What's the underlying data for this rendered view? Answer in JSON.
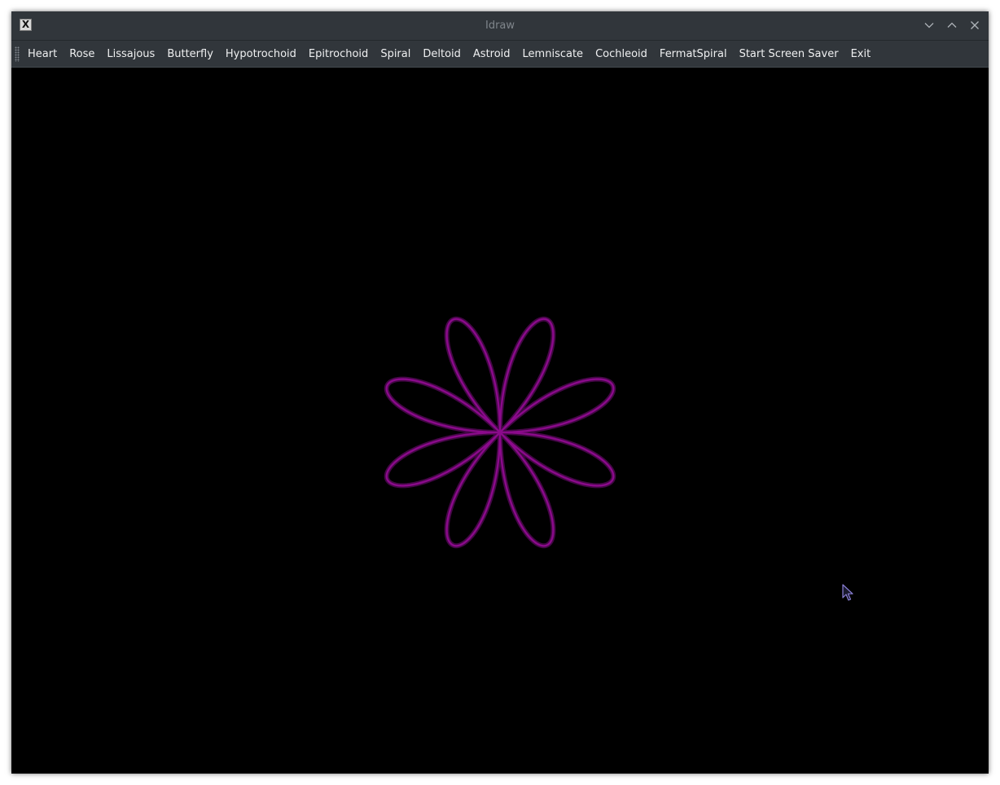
{
  "window": {
    "title": "Idraw",
    "app_icon_glyph": "X"
  },
  "titlebar_buttons": {
    "minimize_icon": "chevron-down-icon",
    "maximize_icon": "chevron-up-icon",
    "close_icon": "close-icon"
  },
  "menu": {
    "items": [
      {
        "label": "Heart"
      },
      {
        "label": "Rose"
      },
      {
        "label": "Lissajous"
      },
      {
        "label": "Butterfly"
      },
      {
        "label": "Hypotrochoid"
      },
      {
        "label": "Epitrochoid"
      },
      {
        "label": "Spiral"
      },
      {
        "label": "Deltoid"
      },
      {
        "label": "Astroid"
      },
      {
        "label": "Lemniscate"
      },
      {
        "label": "Cochleoid"
      },
      {
        "label": "FermatSpiral"
      },
      {
        "label": "Start Screen Saver"
      },
      {
        "label": "Exit"
      }
    ]
  },
  "drawing": {
    "curve": "rose",
    "petals": 8,
    "k": 4,
    "rotation_deg": 22.5,
    "stroke_color": "#8b0a8b",
    "glow_color": "#5a0a5c",
    "background_color": "#000000"
  },
  "colors": {
    "chrome": "#31363b",
    "menu_text": "#eff0f1",
    "title_text": "#7f858b"
  }
}
